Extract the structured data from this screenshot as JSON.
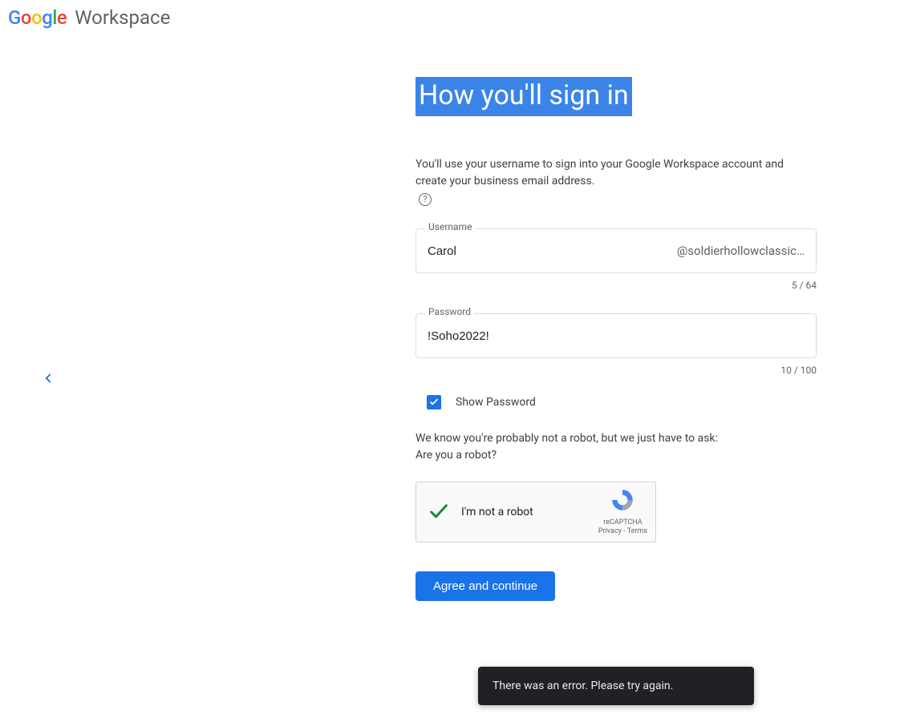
{
  "header": {
    "product": "Workspace"
  },
  "page": {
    "title": "How you'll sign in",
    "subtitle": "You'll use your username to sign into your Google Workspace account and create your business email address."
  },
  "username": {
    "label": "Username",
    "value": "Carol",
    "domain_suffix": "@soldierhollowclassic…",
    "counter": "5 / 64"
  },
  "password": {
    "label": "Password",
    "value": "!Soho2022!",
    "counter": "10 / 100"
  },
  "show_password": {
    "checked": true,
    "label": "Show Password"
  },
  "robot": {
    "text_line1": "We know you're probably not a robot, but we just have to ask:",
    "text_line2": "Are you a robot?",
    "recaptcha_label": "I'm not a robot",
    "recaptcha_brand": "reCAPTCHA",
    "recaptcha_links": "Privacy - Terms"
  },
  "submit": {
    "label": "Agree and continue"
  },
  "toast": {
    "message": "There was an error. Please try again."
  }
}
